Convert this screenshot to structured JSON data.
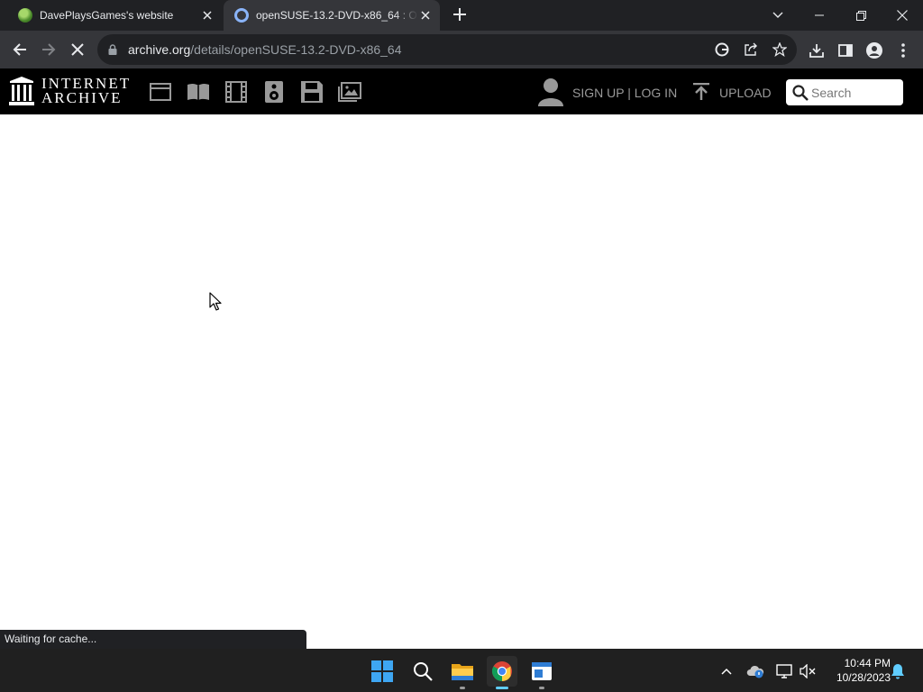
{
  "browser": {
    "tabs": [
      {
        "title": "DavePlaysGames's website",
        "active": false
      },
      {
        "title": "openSUSE-13.2-DVD-x86_64 : O",
        "active": true
      }
    ],
    "url": {
      "domain": "archive.org",
      "path": "/details/openSUSE-13.2-DVD-x86_64"
    },
    "status_text": "Waiting for cache..."
  },
  "archive_nav": {
    "logo_line1": "INTERNET",
    "logo_line2": "ARCHIVE",
    "sign_in_label": "SIGN UP | LOG IN",
    "upload_label": "UPLOAD",
    "search_placeholder": "Search",
    "media_icons": [
      "web-icon",
      "texts-icon",
      "video-icon",
      "audio-icon",
      "software-icon",
      "images-icon"
    ]
  },
  "taskbar": {
    "time": "10:44 PM",
    "date": "10/28/2023",
    "apps": [
      "start-icon",
      "search-icon",
      "file-explorer-icon",
      "chrome-icon",
      "notepad-icon"
    ]
  },
  "colors": {
    "tab_strip": "#202124",
    "toolbar": "#35363a",
    "archive_nav": "#000000",
    "taskbar": "#202020",
    "accent": "#60cdff"
  }
}
